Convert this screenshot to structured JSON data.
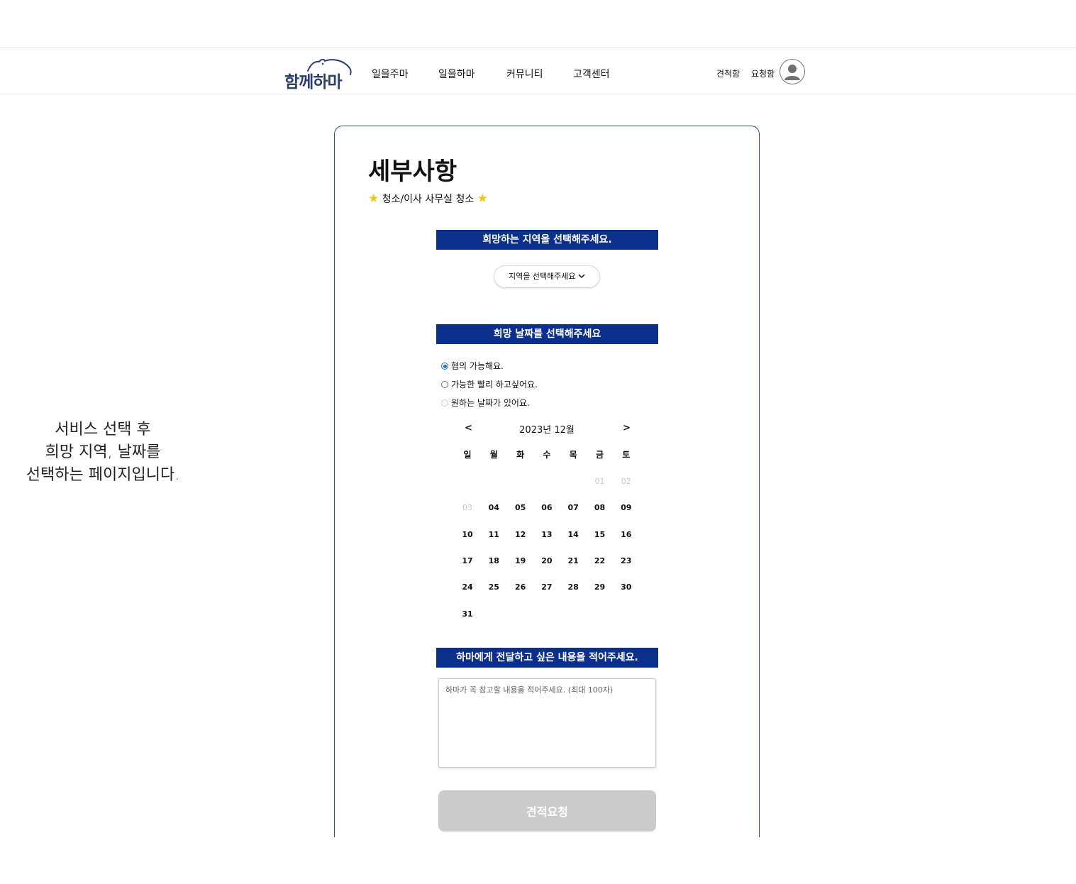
{
  "navbar": {
    "logo_text": "함께하마",
    "menu": [
      "일을주마",
      "일을하마",
      "커뮤니티",
      "고객센터"
    ],
    "quote_box": "견적함",
    "request_box": "요청함",
    "avatar_icon": "user-icon"
  },
  "side_note": {
    "lines": [
      "서비스 선택 후",
      "희망 지역, 날짜를",
      "선택하는 페이지입니다."
    ]
  },
  "card": {
    "title": "세부사항",
    "subtitle": "청소/이사 사무실 청소",
    "subtitle_icon": "star-icon",
    "region": {
      "header": "희망하는 지역을 선택해주세요.",
      "select_label": "지역을 선택해주세요",
      "select_icon": "chevron-down-icon"
    },
    "date": {
      "header": "희망 날짜를 선택해주세요",
      "options": [
        {
          "label": "협의 가능해요.",
          "checked": true
        },
        {
          "label": "가능한 빨리 하고싶어요.",
          "checked": false
        },
        {
          "label": "원하는 날짜가 있어요.",
          "checked": false
        }
      ],
      "calendar": {
        "prev": "<",
        "next": ">",
        "month_label": "2023년 12월",
        "weekdays": [
          "일",
          "월",
          "화",
          "수",
          "목",
          "금",
          "토"
        ],
        "first_weekday": 5,
        "days_in_month": 31,
        "disabled_days": [
          "01",
          "02",
          "03"
        ]
      }
    },
    "memo": {
      "header": "하마에게 전달하고 싶은 내용을 적어주세요.",
      "placeholder": "하마가 꼭 참고할 내용을 적어주세요. (최대 100자)",
      "value": ""
    },
    "submit_label": "견적요청"
  },
  "colors": {
    "brand_navy": "#0a2f8c",
    "logo_color": "#2a3f6e",
    "card_border": "#2b4f9e",
    "radio_checked": "#1a6cd8",
    "star": "#f5c518",
    "button_disabled": "#cbcbcb"
  }
}
